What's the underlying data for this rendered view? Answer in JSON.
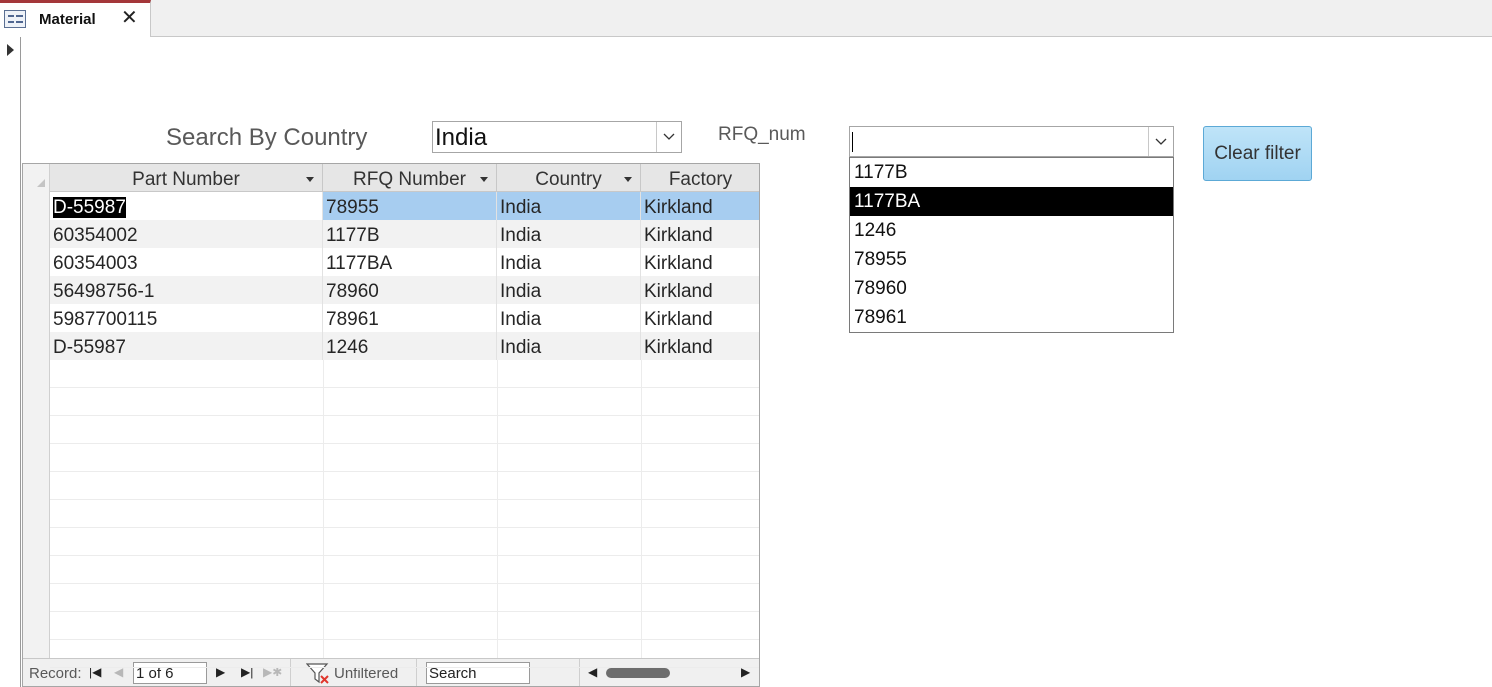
{
  "tab": {
    "title": "Material"
  },
  "filters": {
    "country_label": "Search By Country",
    "country_value": "India",
    "rfq_label": "RFQ_num",
    "rfq_value": "",
    "rfq_options": [
      "1177B",
      "1177BA",
      "1246",
      "78955",
      "78960",
      "78961"
    ],
    "rfq_highlighted": "1177BA",
    "clear_button": "Clear filter"
  },
  "table": {
    "columns": [
      "Part Number",
      "RFQ Number",
      "Country",
      "Factory"
    ],
    "rows": [
      [
        "D-55987",
        "78955",
        "India",
        "Kirkland"
      ],
      [
        "60354002",
        "1177B",
        "India",
        "Kirkland"
      ],
      [
        "60354003",
        "1177BA",
        "India",
        "Kirkland"
      ],
      [
        "56498756-1",
        "78960",
        "India",
        "Kirkland"
      ],
      [
        "5987700115",
        "78961",
        "India",
        "Kirkland"
      ],
      [
        "D-55987",
        "1246",
        "India",
        "Kirkland"
      ]
    ]
  },
  "navigation": {
    "record_label": "Record:",
    "record_position": "1 of 6",
    "filter_status": "Unfiltered",
    "search_text": "Search"
  },
  "colors": {
    "accent_tab": "#a4373a",
    "current_row": "#a7cdf0",
    "button_fill": "#a0d3f2",
    "dropdown_selected": "#000000"
  },
  "icons": {
    "tab": "form-icon",
    "close": "close-icon",
    "record_selector": "record-pointer-icon",
    "combo": "chevron-down-icon",
    "filter": "filter-cleared-icon"
  }
}
